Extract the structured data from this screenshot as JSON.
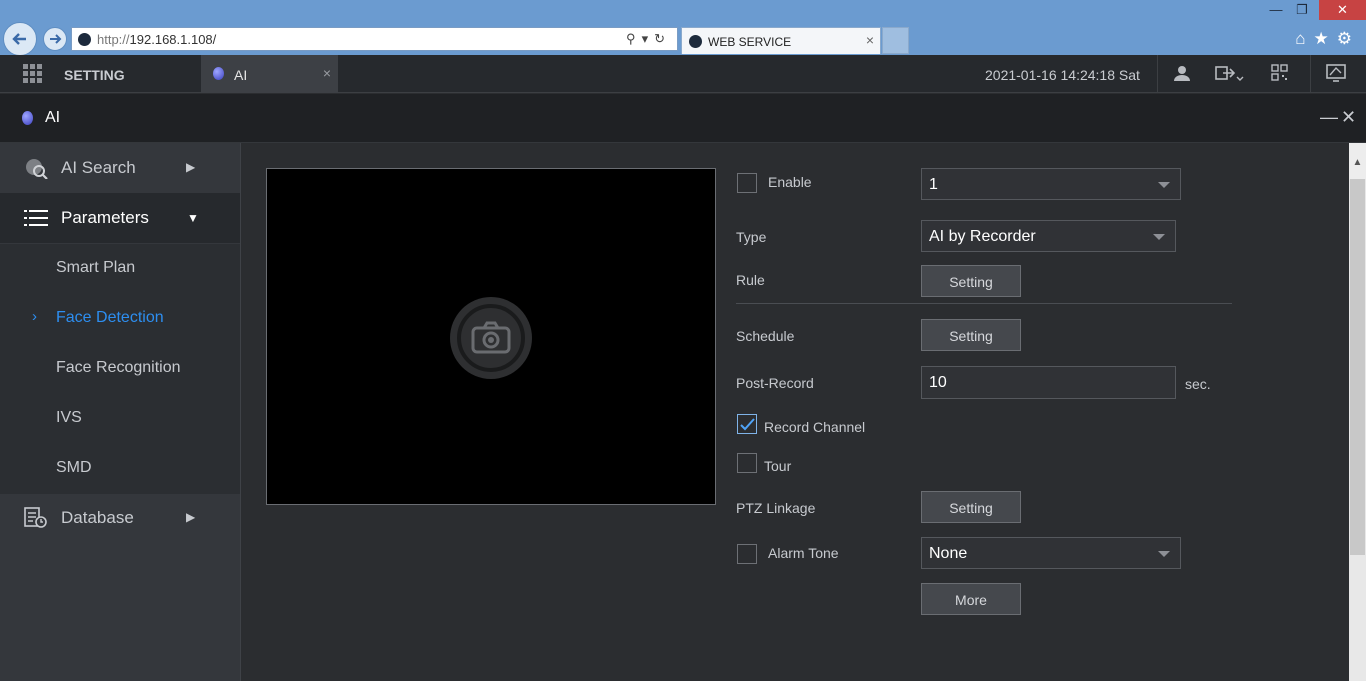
{
  "browser": {
    "url_protocol": "http://",
    "url_host": "192.168.1.108/",
    "tab_title": "WEB SERVICE",
    "tab_close": "×"
  },
  "app_bar": {
    "setting_label": "SETTING",
    "tab_label": "AI",
    "tab_close": "×",
    "datetime": "2021-01-16 14:24:18 Sat"
  },
  "ai_window": {
    "title": "AI",
    "minimize": "—",
    "close": "✕"
  },
  "sidebar": {
    "ai_search": "AI Search",
    "parameters": "Parameters",
    "sub_items": [
      "Smart Plan",
      "Face Detection",
      "Face Recognition",
      "IVS",
      "SMD"
    ],
    "active_sub_index": 1,
    "database": "Database"
  },
  "form": {
    "enable_label": "Enable",
    "enable_checked": false,
    "channel_value": "1",
    "type_label": "Type",
    "type_value": "AI by Recorder",
    "rule_label": "Rule",
    "rule_button": "Setting",
    "schedule_label": "Schedule",
    "schedule_button": "Setting",
    "post_record_label": "Post-Record",
    "post_record_value": "10",
    "post_record_unit": "sec.",
    "record_channel_label": "Record Channel",
    "record_channel_checked": true,
    "tour_label": "Tour",
    "tour_checked": false,
    "ptz_label": "PTZ Linkage",
    "ptz_button": "Setting",
    "alarm_tone_label": "Alarm Tone",
    "alarm_tone_checked": false,
    "alarm_tone_value": "None",
    "more_button": "More"
  },
  "colors": {
    "accent": "#2d8ef0",
    "browser_chrome": "#6b9bd0",
    "app_bar": "#26292d",
    "content_bg": "#2b2d30"
  }
}
